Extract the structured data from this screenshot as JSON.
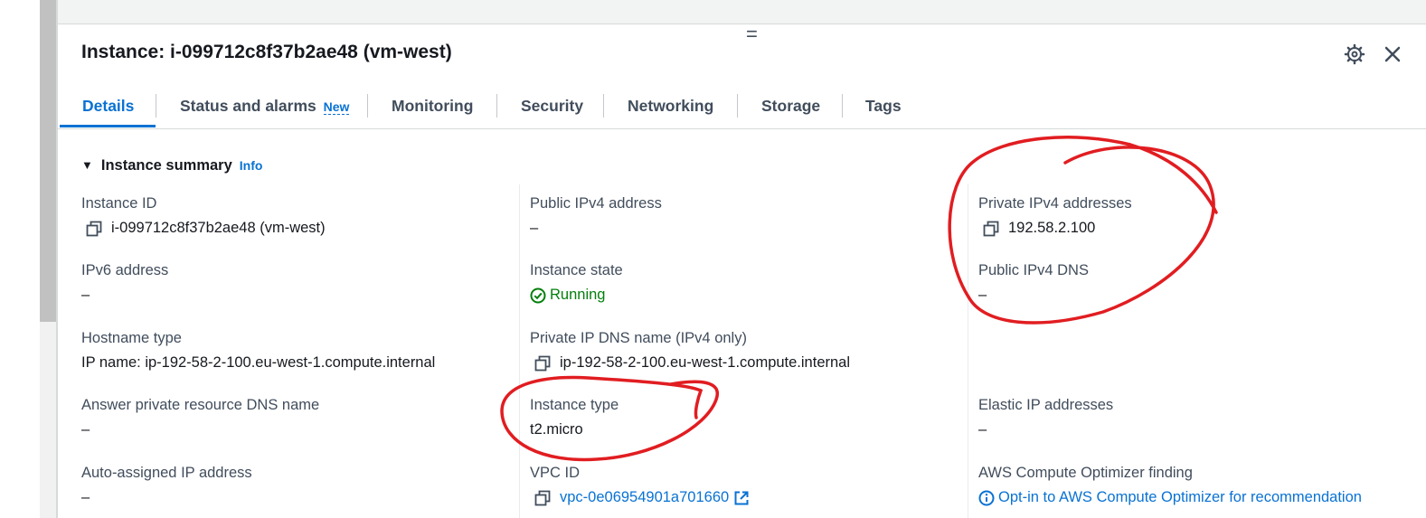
{
  "panel": {
    "title": "Instance: i-099712c8f37b2ae48 (vm-west)"
  },
  "tabs": [
    {
      "label": "Details",
      "active": true
    },
    {
      "label": "Status and alarms",
      "badge": "New"
    },
    {
      "label": "Monitoring"
    },
    {
      "label": "Security"
    },
    {
      "label": "Networking"
    },
    {
      "label": "Storage"
    },
    {
      "label": "Tags"
    }
  ],
  "summary": {
    "header": "Instance summary",
    "info": "Info",
    "fields": {
      "instance_id": {
        "label": "Instance ID",
        "value": "i-099712c8f37b2ae48 (vm-west)"
      },
      "public_ipv4": {
        "label": "Public IPv4 address",
        "value": "–"
      },
      "private_ipv4": {
        "label": "Private IPv4 addresses",
        "value": "192.58.2.100"
      },
      "ipv6": {
        "label": "IPv6 address",
        "value": "–"
      },
      "instance_state": {
        "label": "Instance state",
        "value": "Running"
      },
      "public_ipv4_dns": {
        "label": "Public IPv4 DNS",
        "value": "–"
      },
      "hostname_type": {
        "label": "Hostname type",
        "value": "IP name: ip-192-58-2-100.eu-west-1.compute.internal"
      },
      "private_ip_dns": {
        "label": "Private IP DNS name (IPv4 only)",
        "value": "ip-192-58-2-100.eu-west-1.compute.internal"
      },
      "answer_dns": {
        "label": "Answer private resource DNS name",
        "value": "–"
      },
      "instance_type": {
        "label": "Instance type",
        "value": "t2.micro"
      },
      "elastic_ip": {
        "label": "Elastic IP addresses",
        "value": "–"
      },
      "auto_ip": {
        "label": "Auto-assigned IP address",
        "value": "–"
      },
      "vpc_id": {
        "label": "VPC ID",
        "value": "vpc-0e06954901a701660"
      },
      "optimizer": {
        "label": "AWS Compute Optimizer finding",
        "value": "Opt-in to AWS Compute Optimizer for recommendation"
      }
    }
  },
  "colors": {
    "link": "#0972d3",
    "running": "#037f0c",
    "annotation": "#e11d21"
  },
  "icons": [
    "gear-icon",
    "close-icon",
    "copy-icon",
    "check-circle-icon",
    "external-link-icon",
    "info-circle-icon",
    "caret-down-icon",
    "drag-handle-icon"
  ]
}
